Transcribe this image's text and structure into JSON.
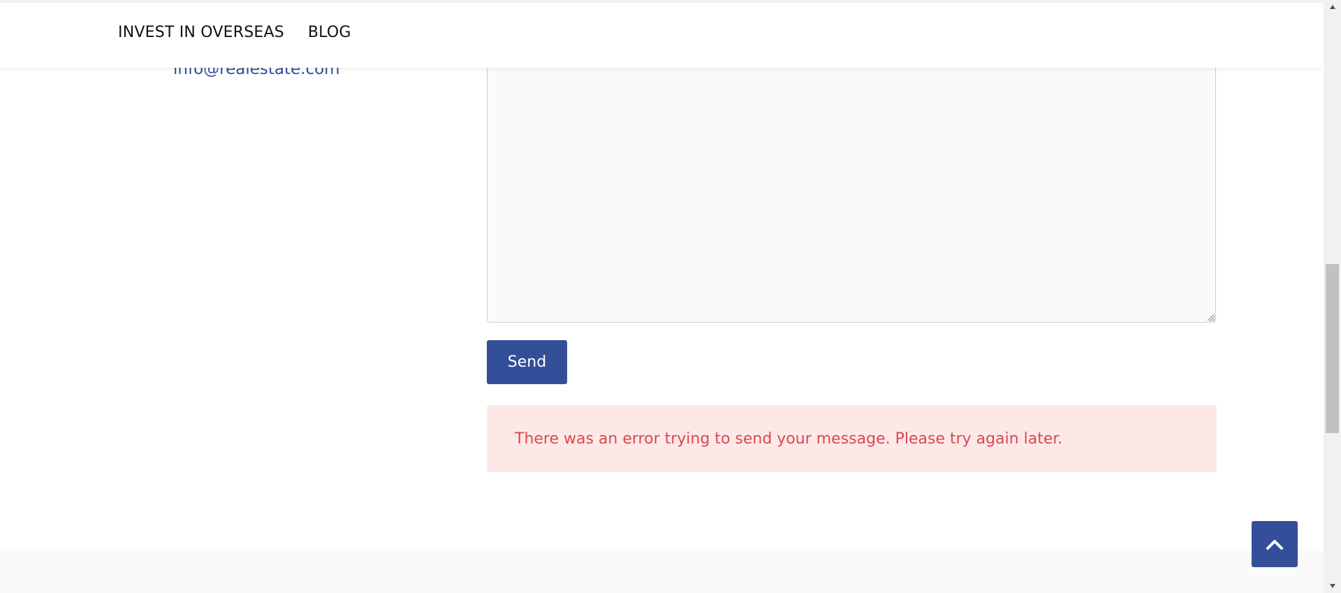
{
  "nav": {
    "items": [
      {
        "label": "INVEST IN OVERSEAS"
      },
      {
        "label": "BLOG"
      }
    ]
  },
  "contact": {
    "email": "info@realestate.com"
  },
  "form": {
    "message_value": "",
    "send_label": "Send"
  },
  "alert": {
    "text": "There was an error trying to send your message. Please try again later."
  },
  "icons": {
    "back_to_top": "chevron-up-icon",
    "scroll_up": "triangle-up-icon",
    "scroll_down": "triangle-down-icon",
    "resize": "resize-grip-icon"
  },
  "colors": {
    "brand": "#344f99",
    "alert_bg": "#fde8e8",
    "alert_text": "#d94a4e"
  }
}
